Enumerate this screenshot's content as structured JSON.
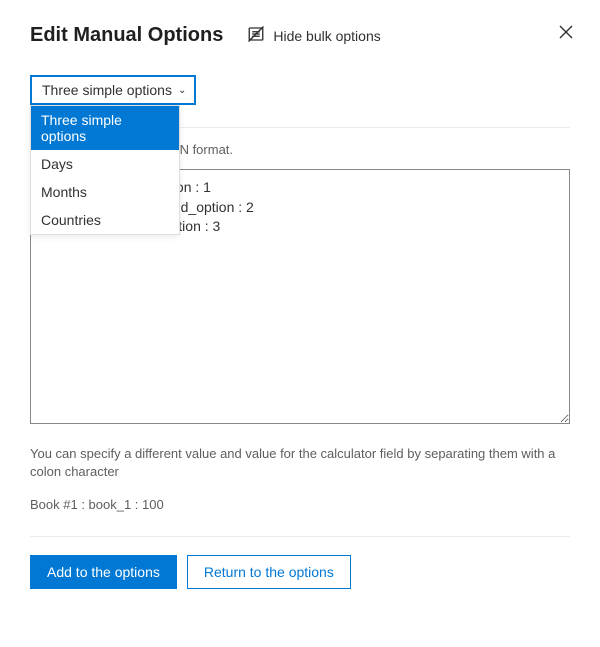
{
  "header": {
    "title": "Edit Manual Options",
    "hide_bulk_label": "Hide bulk options"
  },
  "dropdown": {
    "selected": "Three simple options",
    "options": [
      "Three simple options",
      "Days",
      "Months",
      "Countries"
    ]
  },
  "instruction": "an array of objects in JSON format.",
  "textarea_value": "First Option : first_option : 1\nSecond Option : second_option : 2\nThird Option : third_option : 3",
  "help_text": "You can specify a different value and value for the calculator field by separating them with a colon character",
  "example_text": "Book #1 : book_1 : 100",
  "buttons": {
    "add": "Add to the options",
    "return": "Return to the options"
  }
}
